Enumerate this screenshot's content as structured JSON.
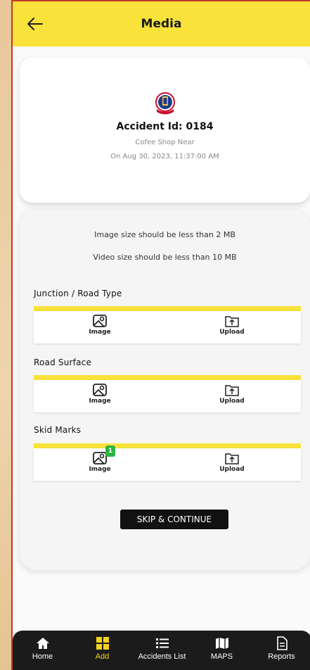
{
  "header": {
    "title": "Media"
  },
  "accident": {
    "id_text": "Accident Id: 0184",
    "location": "Cofee Shop Near",
    "date": "On Aug 30, 2023, 11:37:00 AM"
  },
  "notes": {
    "image_limit": "Image size should be less than 2 MB",
    "video_limit": "Video size should be less than 10 MB"
  },
  "sections": [
    {
      "label": "Junction / Road Type",
      "image_label": "Image",
      "upload_label": "Upload",
      "badge": ""
    },
    {
      "label": "Road Surface",
      "image_label": "Image",
      "upload_label": "Upload",
      "badge": ""
    },
    {
      "label": "Skid Marks",
      "image_label": "Image",
      "upload_label": "Upload",
      "badge": "1"
    }
  ],
  "skip_label": "SKIP & CONTINUE",
  "nav": [
    {
      "label": "Home",
      "icon": "home-icon"
    },
    {
      "label": "Add",
      "icon": "grid-icon",
      "active": true
    },
    {
      "label": "Accidents List",
      "icon": "list-icon"
    },
    {
      "label": "MAPS",
      "icon": "map-icon"
    },
    {
      "label": "Reports",
      "icon": "report-icon"
    }
  ],
  "colors": {
    "accent": "#f9e23a",
    "nav_bg": "#1b1b1b",
    "active": "#f6d31c",
    "badge": "#2fb344"
  }
}
